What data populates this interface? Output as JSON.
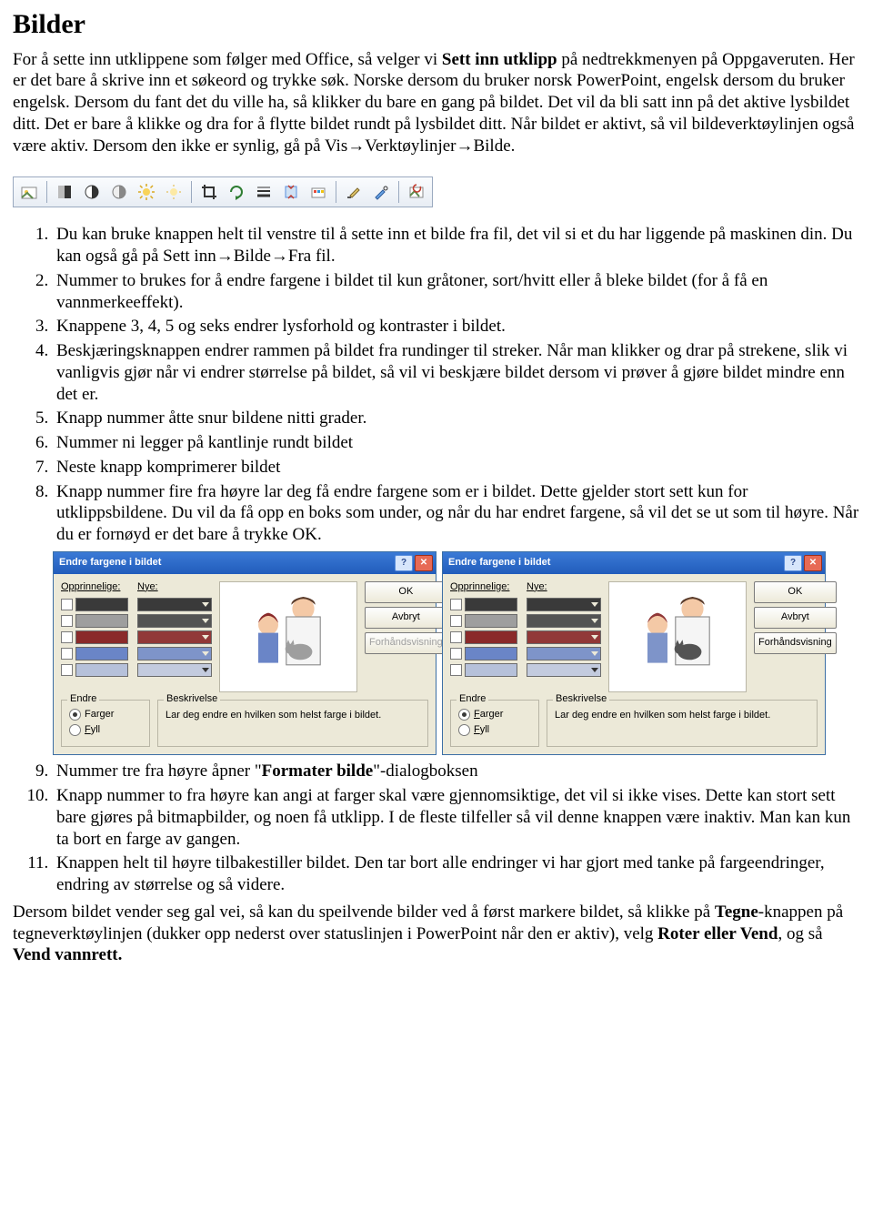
{
  "title": "Bilder",
  "intro": {
    "p1a": "For å sette inn utklippene som følger med Office, så velger vi ",
    "p1b": "Sett inn utklipp",
    "p1c": " på nedtrekkmenyen på Oppgaveruten. Her er det bare å skrive inn et søkeord og trykke søk. Norske dersom du bruker norsk PowerPoint, engelsk dersom du bruker engelsk. Dersom du fant det du ville ha, så klikker du bare en gang på bildet. Det vil da bli satt inn på det aktive lysbildet ditt. Det er bare å klikke og dra for å flytte bildet rundt på lysbildet ditt. Når bildet er aktivt, så vil bildeverktøylinjen også være aktiv. Dersom den ikke er synlig, gå på Vis→Verktøylinjer→Bilde."
  },
  "toolbar_icons": [
    "insert-picture",
    "color-mode",
    "more-contrast",
    "less-contrast",
    "more-brightness",
    "less-brightness",
    "crop",
    "rotate",
    "line-style",
    "compress",
    "recolor",
    "format-picture",
    "set-transparent",
    "reset-picture"
  ],
  "list": {
    "i1": "Du kan bruke knappen helt til venstre til å sette inn et bilde fra fil, det vil si et du har liggende på maskinen din. Du kan også gå på Sett inn→Bilde→Fra fil.",
    "i2": "Nummer to brukes for å endre fargene i bildet til kun gråtoner, sort/hvitt eller å bleke bildet (for å få en vannmerkeeffekt).",
    "i3": "Knappene 3, 4, 5 og seks endrer lysforhold og kontraster i bildet.",
    "i4": "Beskjæringsknappen endrer rammen på bildet fra rundinger til streker. Når man klikker og drar på strekene, slik vi vanligvis gjør når vi endrer størrelse på bildet, så vil vi beskjære bildet dersom vi prøver å gjøre bildet mindre enn det er.",
    "i5": "Knapp nummer åtte snur bildene nitti grader.",
    "i6": "Nummer ni legger på kantlinje rundt bildet",
    "i7": "Neste knapp komprimerer bildet",
    "i8": "Knapp nummer fire fra høyre lar deg få endre fargene som er i bildet. Dette gjelder stort sett kun for utklippsbildene. Du vil da få opp en boks som under, og når du har endret fargene, så vil det se ut som til høyre. Når du er fornøyd er det bare å trykke OK.",
    "i9a": "Nummer tre fra høyre åpner \"",
    "i9b": "Formater bilde",
    "i9c": "\"-dialogboksen",
    "i10": "Knapp nummer to fra høyre kan angi at farger skal være gjennomsiktige, det vil si ikke vises. Dette kan stort sett bare gjøres på bitmapbilder, og noen få utklipp. I de fleste tilfeller så vil denne knappen være inaktiv. Man kan kun ta bort en farge av gangen.",
    "i11": "Knappen helt til høyre tilbakestiller bildet. Den tar bort alle endringer vi har gjort med tanke på fargeendringer, endring av størrelse og så videre."
  },
  "footer": {
    "a": "Dersom bildet vender seg gal vei, så kan du speilvende bilder ved å først markere bildet, så klikke på ",
    "b": "Tegne",
    "c": "-knappen på tegneverktøylinjen (dukker opp nederst over statuslinjen i PowerPoint når den er aktiv), velg ",
    "d": "Roter eller Vend",
    "e": ", og så ",
    "f": "Vend vannrett."
  },
  "dialog": {
    "title": "Endre fargene i bildet",
    "orig": "Opprinnelige:",
    "nye": "Nye:",
    "ok": "OK",
    "avbryt": "Avbryt",
    "preview": "Forhåndsvisning",
    "endre": "Endre",
    "farger": "Farger",
    "fyll": "Fyll",
    "besk": "Beskrivelse",
    "besk_text": "Lar deg endre en hvilken som helst farge i bildet.",
    "left_swatches": [
      "#3a3a3a",
      "#9e9e9e",
      "#8a2a2a",
      "#6a85c7",
      "#b6c1da"
    ],
    "right_swatches": [
      "#3a3a3a",
      "#535353",
      "#913838",
      "#7e94c9",
      "#c3cbde"
    ]
  }
}
